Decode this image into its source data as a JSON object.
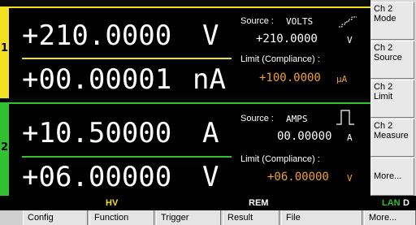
{
  "colors": {
    "ch1_accent": "#f0e020",
    "ch2_accent": "#30c030",
    "limit_value": "#f0a030",
    "hv": "#f0e020",
    "lan": "#30c030"
  },
  "channels": [
    {
      "number": "1",
      "measure_top": {
        "value": "+210.0000",
        "unit": "V"
      },
      "measure_bottom": {
        "value": "+00.00001",
        "unit": "nA"
      },
      "source_label": "Source :",
      "source_mode": "VOLTS",
      "source_icon": "ramp-waveform-icon",
      "source_value": "+210.0000",
      "source_unit": "V",
      "limit_label": "Limit (Compliance) :",
      "limit_value": "+100.0000",
      "limit_unit": "µA"
    },
    {
      "number": "2",
      "measure_top": {
        "value": "+10.50000",
        "unit": "A"
      },
      "measure_bottom": {
        "value": "+06.00000",
        "unit": "V"
      },
      "source_label": "Source :",
      "source_mode": "AMPS",
      "source_icon": "pulse-waveform-icon",
      "source_value": "00.00000",
      "source_unit": "A",
      "limit_label": "Limit (Compliance) :",
      "limit_value": "+06.00000",
      "limit_unit": "V"
    }
  ],
  "softkeys": [
    {
      "line1": "Ch 2",
      "line2": "Mode"
    },
    {
      "line1": "Ch 2",
      "line2": "Source"
    },
    {
      "line1": "Ch 2",
      "line2": "Limit"
    },
    {
      "line1": "Ch 2",
      "line2": "Measure"
    },
    {
      "line1": "More...",
      "line2": ""
    }
  ],
  "status": {
    "hv": "HV",
    "rem": "REM",
    "lan": "LAN",
    "d": "D"
  },
  "menu": [
    "Config",
    "Function",
    "Trigger",
    "Result",
    "File",
    "More..."
  ]
}
